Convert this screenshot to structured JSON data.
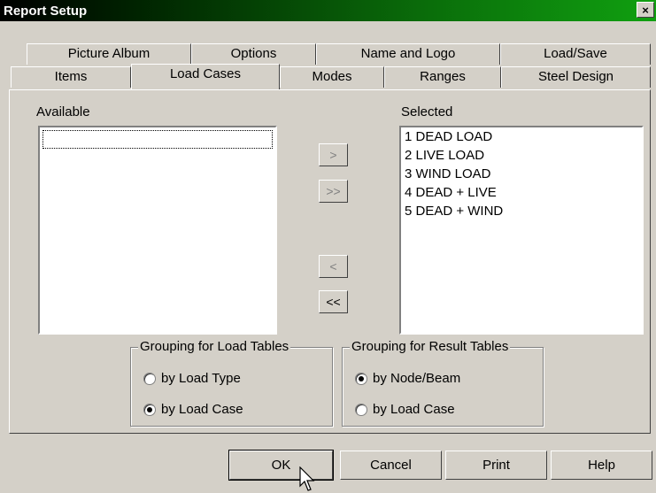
{
  "window": {
    "title": "Report Setup",
    "close_glyph": "×"
  },
  "tabs": {
    "row1": [
      "Picture Album",
      "Options",
      "Name and Logo",
      "Load/Save"
    ],
    "row2": [
      "Items",
      "Load Cases",
      "Modes",
      "Ranges",
      "Steel Design"
    ],
    "active": "Load Cases"
  },
  "available": {
    "label": "Available",
    "items": []
  },
  "selected": {
    "label": "Selected",
    "items": [
      "1 DEAD LOAD",
      "2 LIVE LOAD",
      "3 WIND LOAD",
      "4 DEAD + LIVE",
      "5 DEAD + WIND"
    ]
  },
  "transfer_buttons": {
    "add": ">",
    "add_all": ">>",
    "remove": "<",
    "remove_all": "<<"
  },
  "grouping_load": {
    "title": "Grouping for Load Tables",
    "options": [
      "by Load Type",
      "by Load Case"
    ],
    "selected": "by Load Case"
  },
  "grouping_result": {
    "title": "Grouping for Result Tables",
    "options": [
      "by Node/Beam",
      "by Load Case"
    ],
    "selected": "by Node/Beam"
  },
  "footer": {
    "ok": "OK",
    "cancel": "Cancel",
    "print": "Print",
    "help": "Help"
  },
  "icons": {
    "close": "close-icon",
    "cursor": "mouse-pointer-icon"
  }
}
